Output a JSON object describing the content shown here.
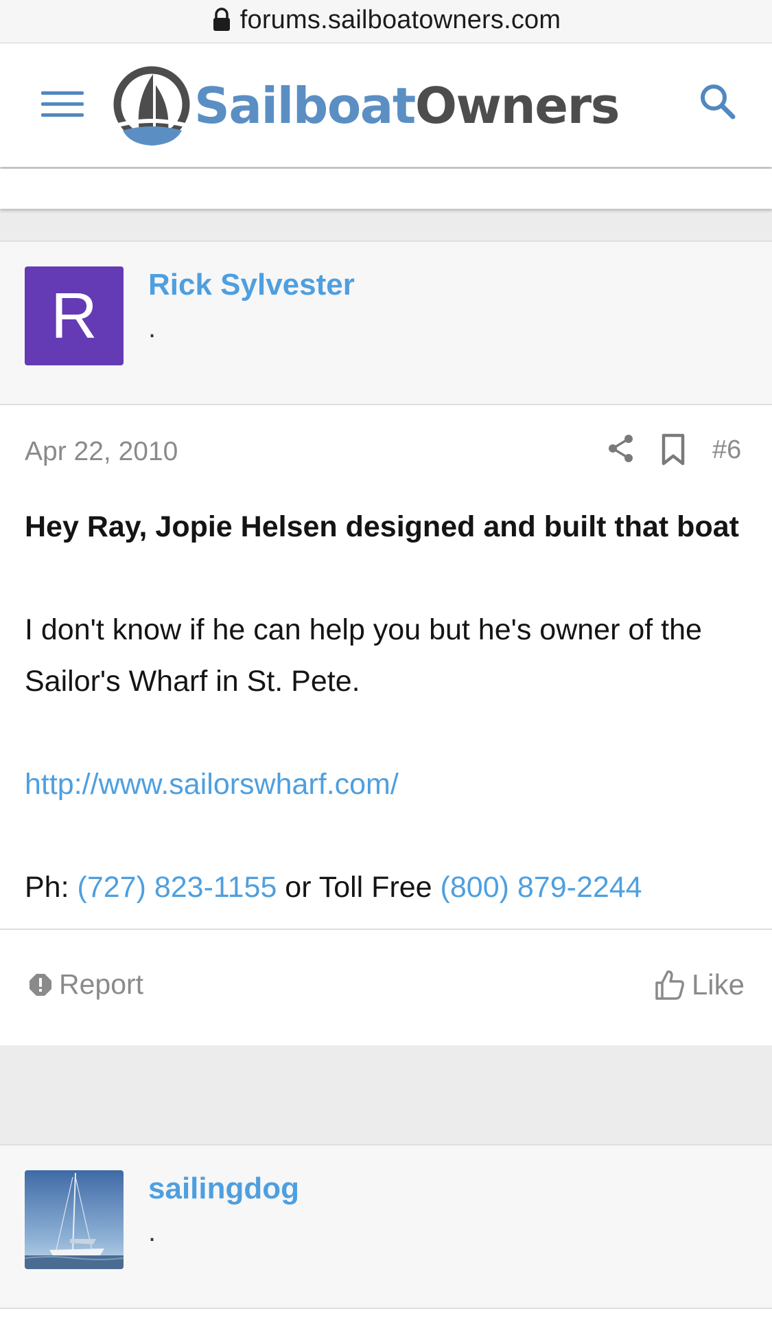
{
  "browser": {
    "url": "forums.sailboatowners.com"
  },
  "header": {
    "brand_part1": "Sailboat",
    "brand_part2": "Owners",
    "icons": {
      "menu": "hamburger-menu-icon",
      "search": "search-icon",
      "logo": "sailboat-logo-icon"
    },
    "colors": {
      "brand_blue": "#5b8fc4",
      "brand_gray": "#4d4d4d"
    }
  },
  "posts": [
    {
      "user": {
        "avatar_letter": "R",
        "avatar_color": "#643ab5",
        "username": "Rick Sylvester",
        "title": "."
      },
      "date": "Apr 22, 2010",
      "number": "#6",
      "body": {
        "line1": "Hey Ray, Jopie Helsen designed and built that boat",
        "line2": "I don't know if he can help you but he's owner of the Sailor's Wharf in St. Pete.",
        "link": "http://www.sailorswharf.com/",
        "phone_prefix": "Ph: ",
        "phone1": "(727) 823-1155",
        "phone_middle": " or Toll Free ",
        "phone2": "(800) 879-2244"
      },
      "actions": {
        "report": "Report",
        "like": "Like"
      }
    },
    {
      "user": {
        "avatar_image": "sailboat-photo",
        "username": "sailingdog",
        "title": "."
      }
    }
  ],
  "colors": {
    "link": "#4e9fdf",
    "muted": "#8a8a8a"
  }
}
